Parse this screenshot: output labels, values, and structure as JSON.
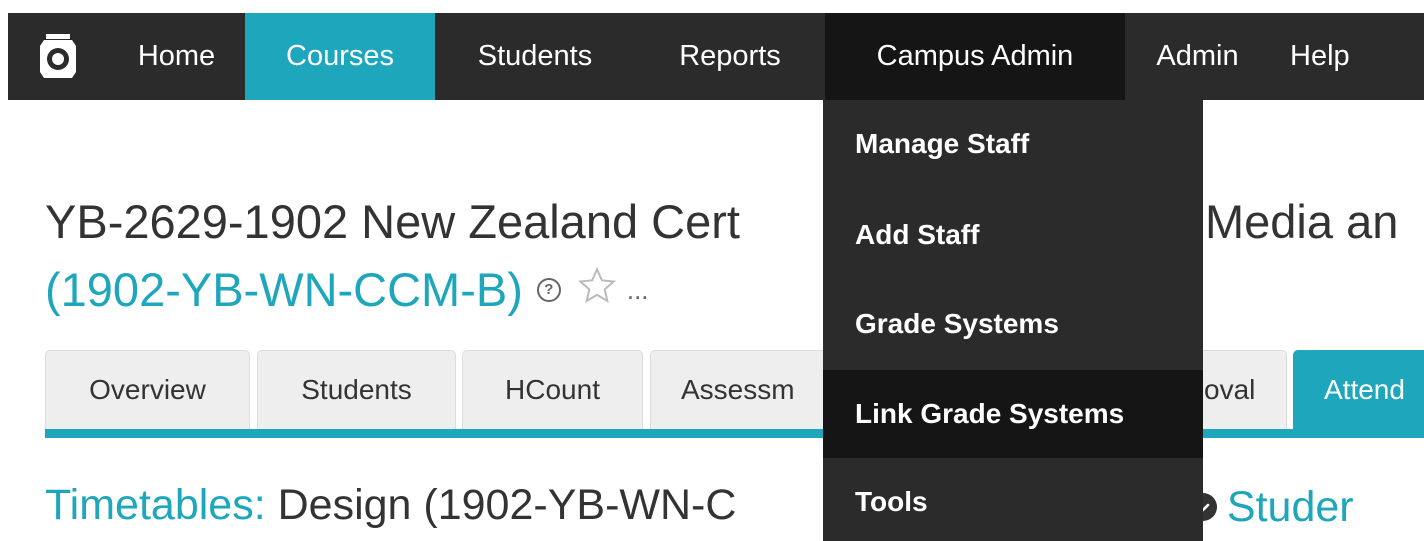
{
  "nav": {
    "items": [
      {
        "label": "Home"
      },
      {
        "label": "Courses"
      },
      {
        "label": "Students"
      },
      {
        "label": "Reports"
      },
      {
        "label": "Campus Admin"
      },
      {
        "label": "Admin"
      },
      {
        "label": "Help"
      }
    ],
    "active": "Courses",
    "open": "Campus Admin"
  },
  "page": {
    "title_text": "YB-2629-1902 New Zealand Cert",
    "title_hidden_tail": "Media an",
    "course_code": "(1902-YB-WN-CCM-B)",
    "more": "..."
  },
  "tabs": [
    {
      "label": "Overview"
    },
    {
      "label": "Students"
    },
    {
      "label": "HCount"
    },
    {
      "label": "Assessm"
    },
    {
      "label": "oval"
    },
    {
      "label": "Attend"
    }
  ],
  "timetables": {
    "label": "Timetables:",
    "value": "Design (1902-YB-WN-C",
    "tail_dot": "e",
    "link": "Studer"
  },
  "dropdown": {
    "items": [
      {
        "label": "Manage Staff"
      },
      {
        "label": "Add Staff"
      },
      {
        "label": "Grade Systems"
      },
      {
        "label": "Link Grade Systems"
      },
      {
        "label": "Tools"
      }
    ],
    "highlighted": "Link Grade Systems"
  },
  "colors": {
    "nav_bg": "#2b2b2b",
    "accent": "#1ea6bd",
    "dropdown_bg": "#2b2b2b",
    "dropdown_highlight": "#151515"
  }
}
